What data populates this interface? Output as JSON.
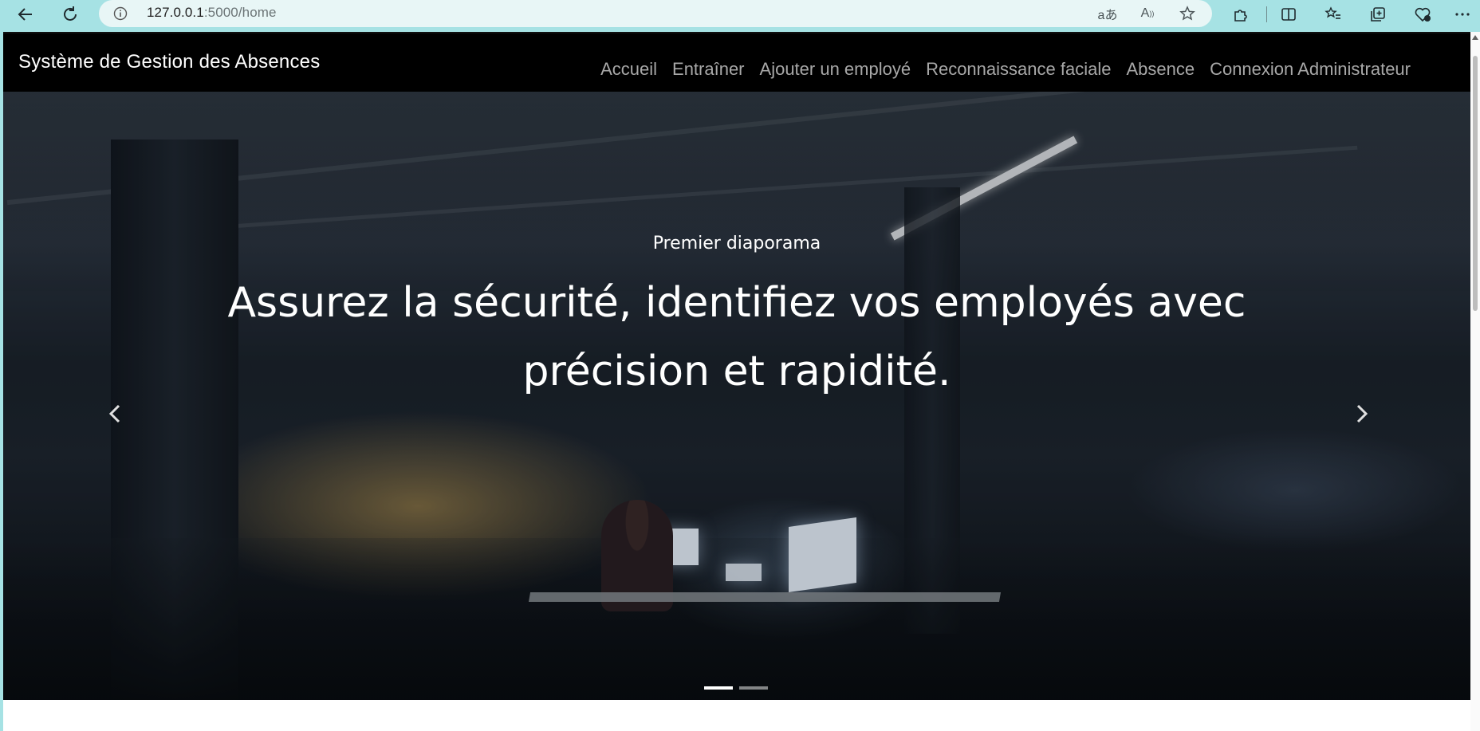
{
  "browser": {
    "url_host": "127.0.0.1",
    "url_rest": ":5000/home"
  },
  "navbar": {
    "brand": "Système de Gestion des Absences",
    "links": [
      {
        "label": "Accueil"
      },
      {
        "label": "Entraîner"
      },
      {
        "label": "Ajouter un employé"
      },
      {
        "label": "Reconnaissance faciale"
      },
      {
        "label": "Absence"
      },
      {
        "label": "Connexion Administrateur"
      }
    ]
  },
  "carousel": {
    "caption_small": "Premier diaporama",
    "caption_line1": "Assurez la sécurité, identifiez vos employés avec",
    "caption_line2": "précision et rapidité.",
    "slide_count": 2,
    "active_index": 0
  },
  "icons": {
    "back": "arrow-left-icon",
    "reload": "reload-icon",
    "info": "info-icon",
    "translate": "translate-icon",
    "read_aloud": "read-aloud-icon",
    "favorite": "star-icon",
    "extensions": "puzzle-icon",
    "split": "split-screen-icon",
    "favorites_list": "favorites-icon",
    "collections": "collections-icon",
    "health": "heart-icon",
    "more": "more-icon",
    "prev": "chevron-left-icon",
    "next": "chevron-right-icon"
  },
  "colors": {
    "chrome_bg": "#a6e2e4",
    "navbar_bg": "#000000",
    "nav_link": "#a8a8a8"
  }
}
